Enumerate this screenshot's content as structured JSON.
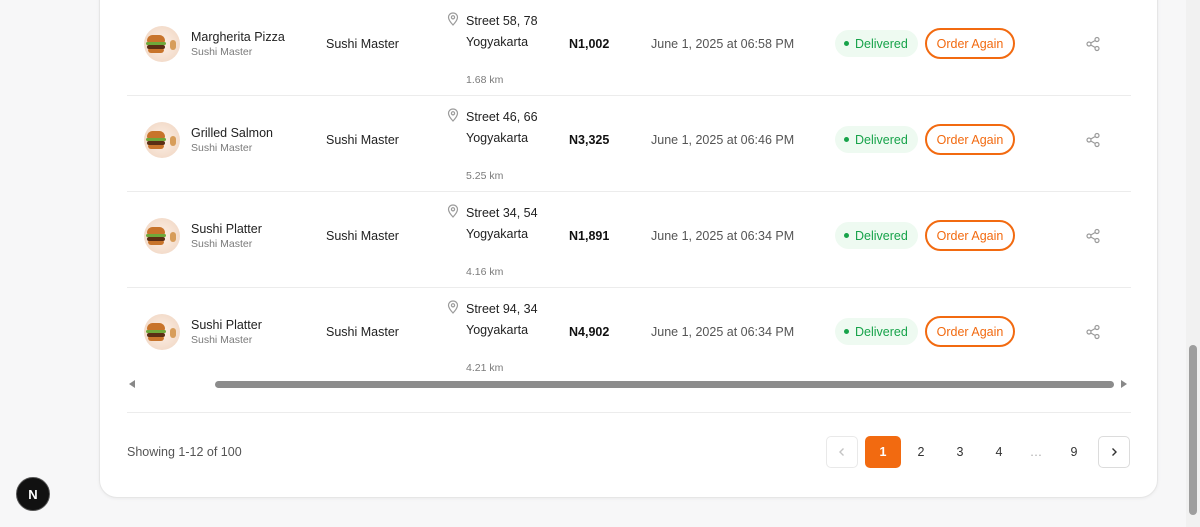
{
  "orders": [
    {
      "item": "Margherita Pizza",
      "restaurant_sub": "Sushi Master",
      "restaurant": "Sushi Master",
      "address": "Street 58, 78 Yogyakarta",
      "distance": "1.68 km",
      "price": "N1,002",
      "date": "June 1, 2025 at 06:58 PM",
      "status": "Delivered",
      "action": "Order Again"
    },
    {
      "item": "Grilled Salmon",
      "restaurant_sub": "Sushi Master",
      "restaurant": "Sushi Master",
      "address": "Street 46, 66 Yogyakarta",
      "distance": "5.25 km",
      "price": "N3,325",
      "date": "June 1, 2025 at 06:46 PM",
      "status": "Delivered",
      "action": "Order Again"
    },
    {
      "item": "Sushi Platter",
      "restaurant_sub": "Sushi Master",
      "restaurant": "Sushi Master",
      "address": "Street 34, 54 Yogyakarta",
      "distance": "4.16 km",
      "price": "N1,891",
      "date": "June 1, 2025 at 06:34 PM",
      "status": "Delivered",
      "action": "Order Again"
    },
    {
      "item": "Sushi Platter",
      "restaurant_sub": "Sushi Master",
      "restaurant": "Sushi Master",
      "address": "Street 94, 34 Yogyakarta",
      "distance": "4.21 km",
      "price": "N4,902",
      "date": "June 1, 2025 at 06:34 PM",
      "status": "Delivered",
      "action": "Order Again"
    }
  ],
  "pagination": {
    "showing": "Showing 1-12 of 100",
    "pages": [
      "1",
      "2",
      "3",
      "4",
      "…",
      "9"
    ],
    "current": "1",
    "prev_icon": "chevron-left-icon",
    "next_icon": "chevron-right-icon"
  },
  "badge": {
    "label": "N",
    "icon": "nextjs-logo"
  },
  "colors": {
    "accent": "#f26a10",
    "delivered": "#17a34a",
    "delivered_bg": "#eefaf1"
  },
  "icons": {
    "location": "map-pin-icon",
    "share": "share-icon",
    "thumbnail": "burger-food-image"
  }
}
